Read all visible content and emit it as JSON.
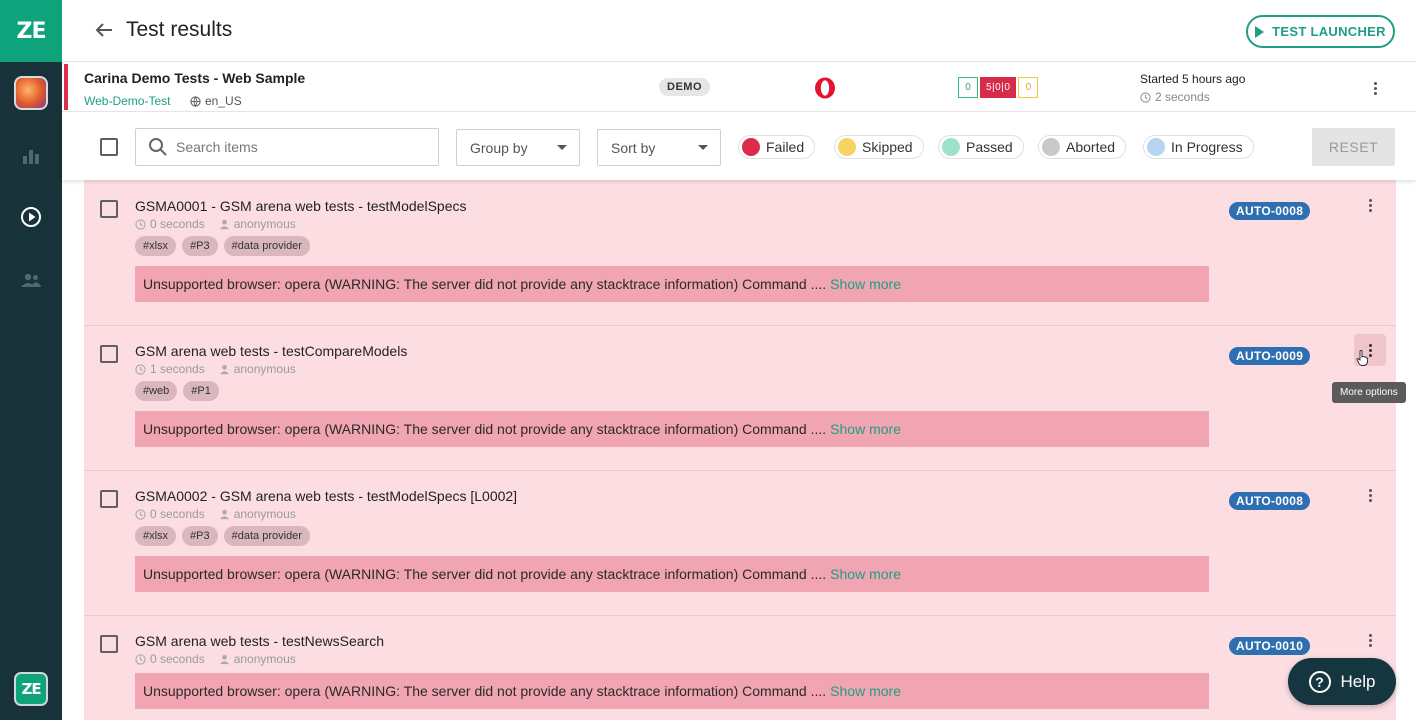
{
  "app": {
    "logo_text": "ZE"
  },
  "sidebar": {
    "bottom_logo_text": "ZE"
  },
  "header": {
    "title": "Test results",
    "launcher_label": "TEST LAUNCHER"
  },
  "run": {
    "name": "Carina Demo Tests - Web Sample",
    "job": "Web-Demo-Test",
    "locale": "en_US",
    "env": "DEMO",
    "browser_icon": "opera-icon",
    "stats": {
      "passed": "0",
      "failed": "5|0|0",
      "skipped": "0"
    },
    "started": "Started 5 hours ago",
    "duration": "2 seconds"
  },
  "toolbar": {
    "search_placeholder": "Search items",
    "group_by": "Group by",
    "sort_by": "Sort by",
    "statuses": [
      {
        "label": "Failed",
        "color": "#dc2c4a"
      },
      {
        "label": "Skipped",
        "color": "#f4d463"
      },
      {
        "label": "Passed",
        "color": "#9ee3c9"
      },
      {
        "label": "Aborted",
        "color": "#c9c9c9"
      },
      {
        "label": "In Progress",
        "color": "#b7d5f1"
      }
    ],
    "reset_label": "RESET"
  },
  "tests": [
    {
      "title": "GSMA0001 - GSM arena web tests - testModelSpecs",
      "duration": "0 seconds",
      "owner": "anonymous",
      "tags": [
        "#xlsx",
        "#P3",
        "#data provider"
      ],
      "error": "Unsupported browser: opera (WARNING: The server did not provide any stacktrace information) Command ....",
      "show_more": "Show more",
      "issue": "AUTO-0008"
    },
    {
      "title": "GSM arena web tests - testCompareModels",
      "duration": "1 seconds",
      "owner": "anonymous",
      "tags": [
        "#web",
        "#P1"
      ],
      "error": "Unsupported browser: opera (WARNING: The server did not provide any stacktrace information) Command ....",
      "show_more": "Show more",
      "issue": "AUTO-0009"
    },
    {
      "title": "GSMA0002 - GSM arena web tests - testModelSpecs [L0002]",
      "duration": "0 seconds",
      "owner": "anonymous",
      "tags": [
        "#xlsx",
        "#P3",
        "#data provider"
      ],
      "error": "Unsupported browser: opera (WARNING: The server did not provide any stacktrace information) Command ....",
      "show_more": "Show more",
      "issue": "AUTO-0008"
    },
    {
      "title": "GSM arena web tests - testNewsSearch",
      "duration": "0 seconds",
      "owner": "anonymous",
      "tags": [],
      "error": "Unsupported browser: opera (WARNING: The server did not provide any stacktrace information) Command ....",
      "show_more": "Show more",
      "issue": "AUTO-0010"
    }
  ],
  "tooltip": "More options",
  "help_label": "Help"
}
